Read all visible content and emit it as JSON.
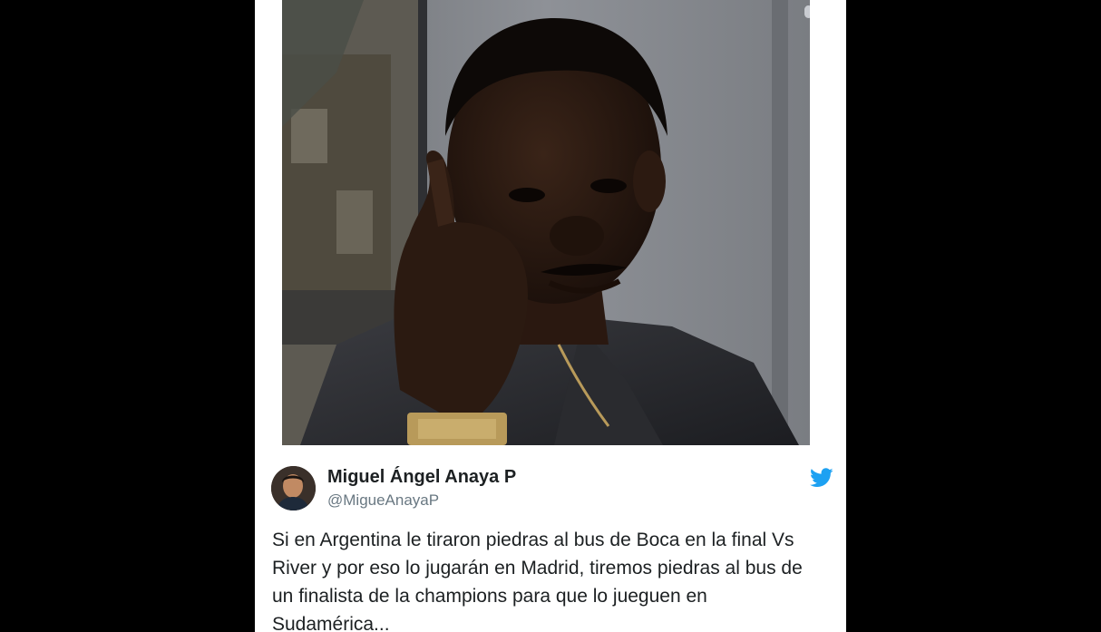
{
  "tweet": {
    "author_name": "Miguel Ángel Anaya P",
    "author_handle": "@MigueAnayaP",
    "text": "Si en Argentina le tiraron piedras al bus de Boca en la final Vs River y por eso lo jugarán en Madrid, tiremos piedras al bus de un finalista de la champions para que lo jueguen en Sudamérica...",
    "icons": {
      "network": "twitter-bird-icon",
      "avatar": "avatar"
    }
  },
  "colors": {
    "page_background": "#000000",
    "card_background": "#ffffff",
    "name_text": "#1c2022",
    "handle_text": "#697882",
    "twitter_blue": "#1da1f2"
  }
}
